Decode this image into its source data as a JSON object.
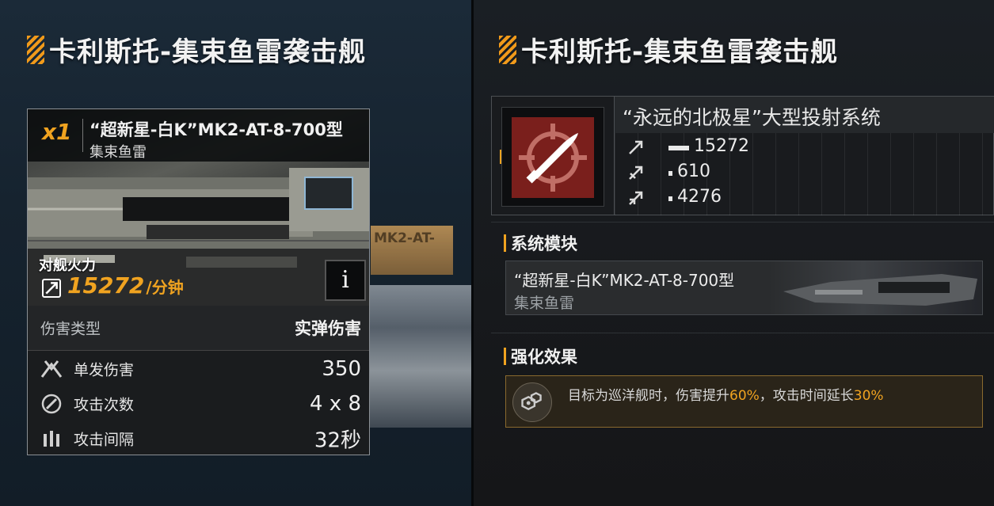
{
  "left": {
    "title": "卡利斯托-集束鱼雷袭击舰",
    "card": {
      "quantity": "x1",
      "weapon_name": "“超新星-白K”MK2-AT-8-700型",
      "weapon_type": "集束鱼雷",
      "firepower_label": "对舰火力",
      "firepower_value": "15272",
      "firepower_unit": "/分钟",
      "info_label": "i",
      "damage_type_label": "伤害类型",
      "damage_type_value": "实弹伤害",
      "stats": [
        {
          "label": "单发伤害",
          "value": "350",
          "icon": "impact-icon"
        },
        {
          "label": "攻击次数",
          "value": "4 x 8",
          "icon": "attack-count-icon"
        },
        {
          "label": "攻击间隔",
          "value": "32秒",
          "icon": "interval-icon"
        }
      ]
    },
    "background_text": "MK2-AT-"
  },
  "right": {
    "title": "卡利斯托-集束鱼雷袭击舰",
    "system": {
      "name": "“永远的北极星”大型投射系统",
      "stats": [
        {
          "value": "15272",
          "icon": "anti-ship-icon"
        },
        {
          "value": "610",
          "icon": "anti-aircraft-icon"
        },
        {
          "value": "4276",
          "icon": "siege-icon"
        }
      ]
    },
    "module_section": "系统模块",
    "module": {
      "name": "“超新星-白K”MK2-AT-8-700型",
      "sub": "集束鱼雷"
    },
    "effect_section": "强化效果",
    "effect": {
      "text_1": "目标为巡洋舰时，伤害提升",
      "pct_1": "60%",
      "text_2": "，攻击时间延长",
      "pct_2": "30%"
    }
  },
  "colors": {
    "accent": "#f0a320",
    "weapon_icon_bg": "#7a1f1c"
  }
}
